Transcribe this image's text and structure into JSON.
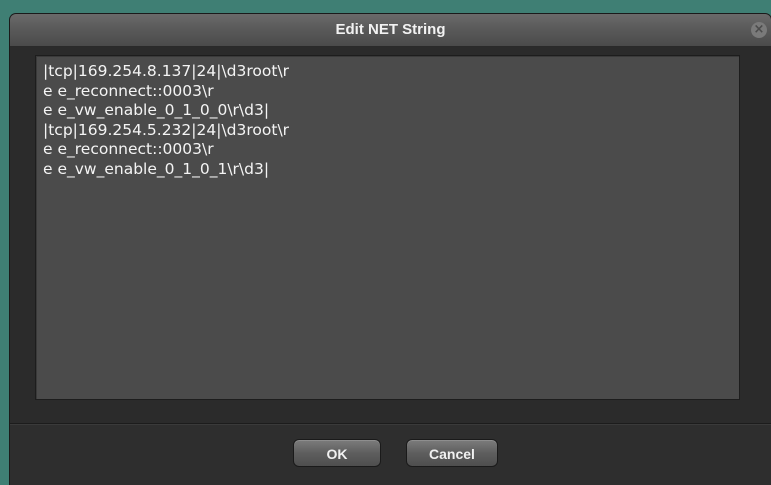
{
  "dialog": {
    "title": "Edit NET String",
    "close_glyph": "×",
    "text_lines": [
      "|tcp|169.254.8.137|24|\\d3root\\r",
      "e e_reconnect::0003\\r",
      "e e_vw_enable_0_1_0_0\\r\\d3|",
      "|tcp|169.254.5.232|24|\\d3root\\r",
      "e e_reconnect::0003\\r",
      "e e_vw_enable_0_1_0_1\\r\\d3|"
    ],
    "ok_label": "OK",
    "cancel_label": "Cancel"
  },
  "colors": {
    "background": "#3f7f74",
    "window": "#2a2a2a",
    "editor": "#4b4b4b",
    "text": "#f4f4f4"
  }
}
